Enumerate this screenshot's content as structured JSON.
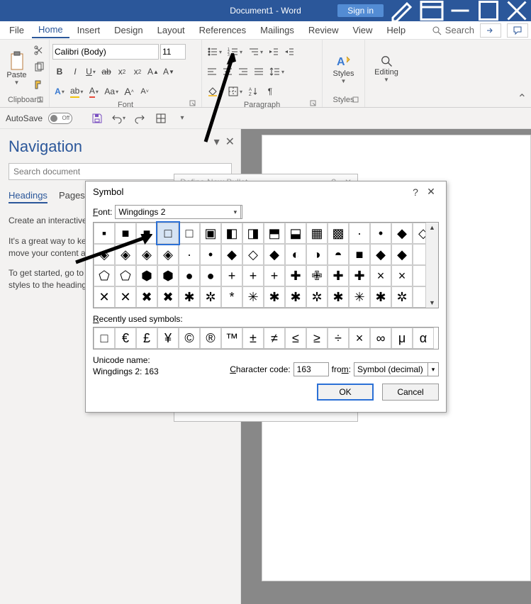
{
  "titlebar": {
    "doc_title": "Document1 - Word",
    "sign_in": "Sign in"
  },
  "menu": {
    "file": "File",
    "home": "Home",
    "insert": "Insert",
    "design": "Design",
    "layout": "Layout",
    "references": "References",
    "mailings": "Mailings",
    "review": "Review",
    "view": "View",
    "help": "Help",
    "search": "Search"
  },
  "ribbon": {
    "clipboard": {
      "label": "Clipboard",
      "paste": "Paste"
    },
    "font": {
      "label": "Font",
      "name": "Calibri (Body)",
      "size": "11"
    },
    "paragraph": {
      "label": "Paragraph"
    },
    "styles": {
      "label": "Styles",
      "button": "Styles"
    },
    "editing": {
      "label": "",
      "button": "Editing"
    }
  },
  "qat": {
    "autosave": "AutoSave",
    "off": "Off"
  },
  "nav": {
    "title": "Navigation",
    "search_placeholder": "Search document",
    "tab_headings": "Headings",
    "tab_pages": "Pages",
    "p1": "Create an interactive outline of your document.",
    "p2": "It's a great way to keep track of where you are or quickly move your content around.",
    "p3": "To get started, go to the Home tab and apply Heading styles to the headings in your document."
  },
  "bg_dialog": {
    "title": "Define New Bullet"
  },
  "dialog": {
    "title": "Symbol",
    "font_label": "Font:",
    "font_value": "Wingdings 2",
    "recent_label": "Recently used symbols:",
    "unicode_name_label": "Unicode name:",
    "unicode_name_value": "Wingdings 2: 163",
    "char_code_label": "Character code:",
    "char_code_value": "163",
    "from_label": "from:",
    "from_value": "Symbol (decimal)",
    "ok": "OK",
    "cancel": "Cancel",
    "symbols": [
      "▪",
      "■",
      "■",
      "□",
      "□",
      "▣",
      "◧",
      "◨",
      "⬒",
      "⬓",
      "▦",
      "▩",
      "·",
      "•",
      "◆",
      "◇",
      "◈",
      "◈",
      "◈",
      "◈",
      "·",
      "•",
      "◆",
      "◇",
      "◆",
      "◐",
      "◑",
      "◓",
      "■",
      "◆",
      "◆",
      "",
      "⬠",
      "⬠",
      "⬢",
      "⬢",
      "●",
      "●",
      "+",
      "+",
      "+",
      "✚",
      "✙",
      "✚",
      "✚",
      "×",
      "×",
      "",
      "✕",
      "✕",
      "✖",
      "✖",
      "✱",
      "✲",
      "*",
      "✳",
      "✱",
      "✱",
      "✲",
      "✱",
      "✳",
      "✱",
      "✲",
      ""
    ],
    "selected_index": 3,
    "recent": [
      "□",
      "€",
      "£",
      "¥",
      "©",
      "®",
      "™",
      "±",
      "≠",
      "≤",
      "≥",
      "÷",
      "×",
      "∞",
      "μ",
      "α"
    ]
  }
}
